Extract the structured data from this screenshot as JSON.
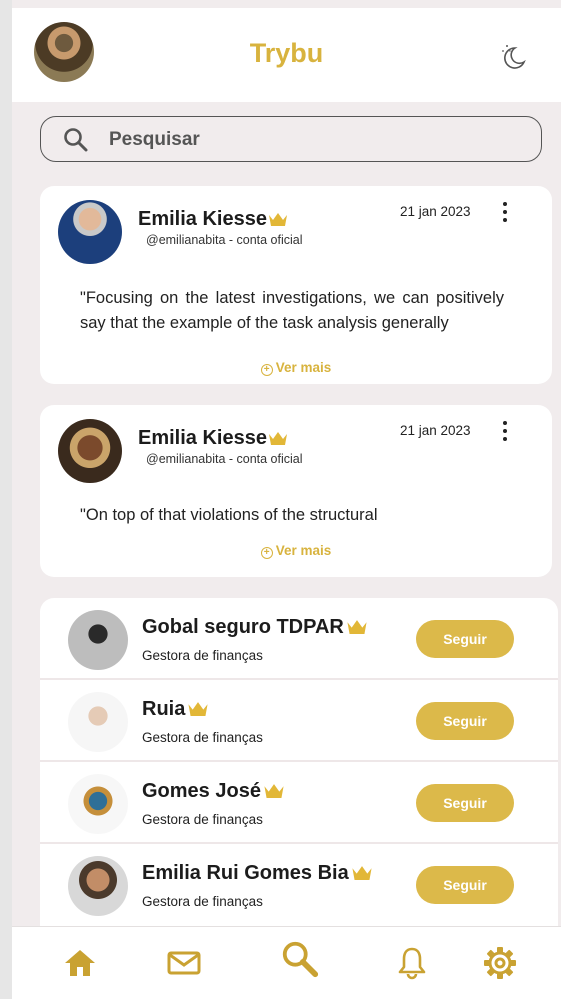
{
  "app": {
    "title": "Trybu"
  },
  "search": {
    "placeholder": "Pesquisar"
  },
  "posts": [
    {
      "name": "Emilia Kiesse",
      "handle": "@emilianabita - conta oficial",
      "date": "21 jan 2023",
      "text": "\"Focusing on the latest investigations, we can positively say that the example of the task analysis generally",
      "more": "Ver mais"
    },
    {
      "name": "Emilia Kiesse",
      "handle": "@emilianabita - conta oficial",
      "date": "21 jan 2023",
      "text": "\"On top of that violations of the structural",
      "more": "Ver mais"
    }
  ],
  "suggestions": [
    {
      "name": "Gobal seguro TDPAR",
      "role": "Gestora de finanças",
      "action": "Seguir"
    },
    {
      "name": "Ruia",
      "role": "Gestora de finanças",
      "action": "Seguir"
    },
    {
      "name": "Gomes José",
      "role": "Gestora de finanças",
      "action": "Seguir"
    },
    {
      "name": "Emilia Rui Gomes Bia",
      "role": "Gestora de finanças",
      "action": "Seguir"
    }
  ],
  "nav": {
    "items": [
      "home-icon",
      "mail-icon",
      "search-icon",
      "bell-icon",
      "gear-icon"
    ]
  },
  "colors": {
    "accent": "#d8b33e",
    "button": "#dcb94a",
    "background": "#f1eced"
  }
}
